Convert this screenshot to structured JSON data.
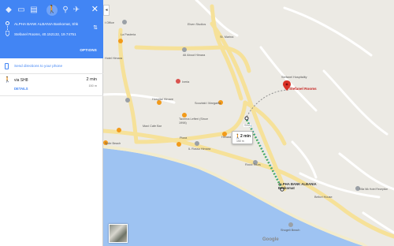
{
  "colors": {
    "header_blue": "#4285f4",
    "route_dot": "#2a8fe0",
    "walk_green": "#4caf50",
    "dest_red": "#d93025",
    "road_yellow": "#f6e199",
    "water_blue": "#9ec3f2"
  },
  "travel_modes": [
    {
      "name": "best-route-icon",
      "glyph": "◆"
    },
    {
      "name": "car-icon",
      "glyph": "▭"
    },
    {
      "name": "transit-icon",
      "glyph": "▤"
    },
    {
      "name": "walk-icon",
      "glyph": "🚶",
      "active": true
    },
    {
      "name": "cycle-icon",
      "glyph": "⚲"
    },
    {
      "name": "flight-icon",
      "glyph": "✈"
    }
  ],
  "directions": {
    "origin": "ALPHA BANK ALBANIA Bankomat, Shk",
    "destination": "Stefanel Rooms, 40.152132, 19.74751",
    "options_label": "OPTIONS",
    "send_to_phone": "Send directions to your phone"
  },
  "trip": {
    "via": "via SH8",
    "time": "2 min",
    "distance": "150 m",
    "details_label": "DETAILS"
  },
  "map": {
    "bubble_time": "2 min",
    "bubble_distance": "150 m",
    "google_logo": "Google",
    "labels": {
      "office": "t Office",
      "elven_studios": "Elven Studios",
      "st_marina": "St. Marina",
      "la_pasteria": "La Pasteria",
      "all_about_himara": "All About Himara",
      "iveria": "Iveria",
      "hotel_sthimara": "Hotel Himara",
      "hospital_himare": "Hospital Himare",
      "stefanel_rooms": "Stefanel Rooms",
      "stefanel_hospitality": "Stefanel Hospitality",
      "souvlaki": "Souvlaki i Margarita",
      "taverna": "Taverna Lefteri (Since 1998)",
      "maxi_cafe": "Maxi Cafe Bar",
      "himara_inn": "Himara Inn",
      "pizza": "Pizza",
      "il_rosso": "IL Rosso Himara",
      "spile_beach": "Spile Beach",
      "rocci": "Rocci Tours",
      "alpha_bank": "ALPHA BANK ALBANIA Bankomat",
      "villa_nik": "Villa Nik Hotel Reception",
      "bellori": "Bellori House",
      "shogeli": "Shogeli Beach",
      "road": "SH8"
    }
  }
}
